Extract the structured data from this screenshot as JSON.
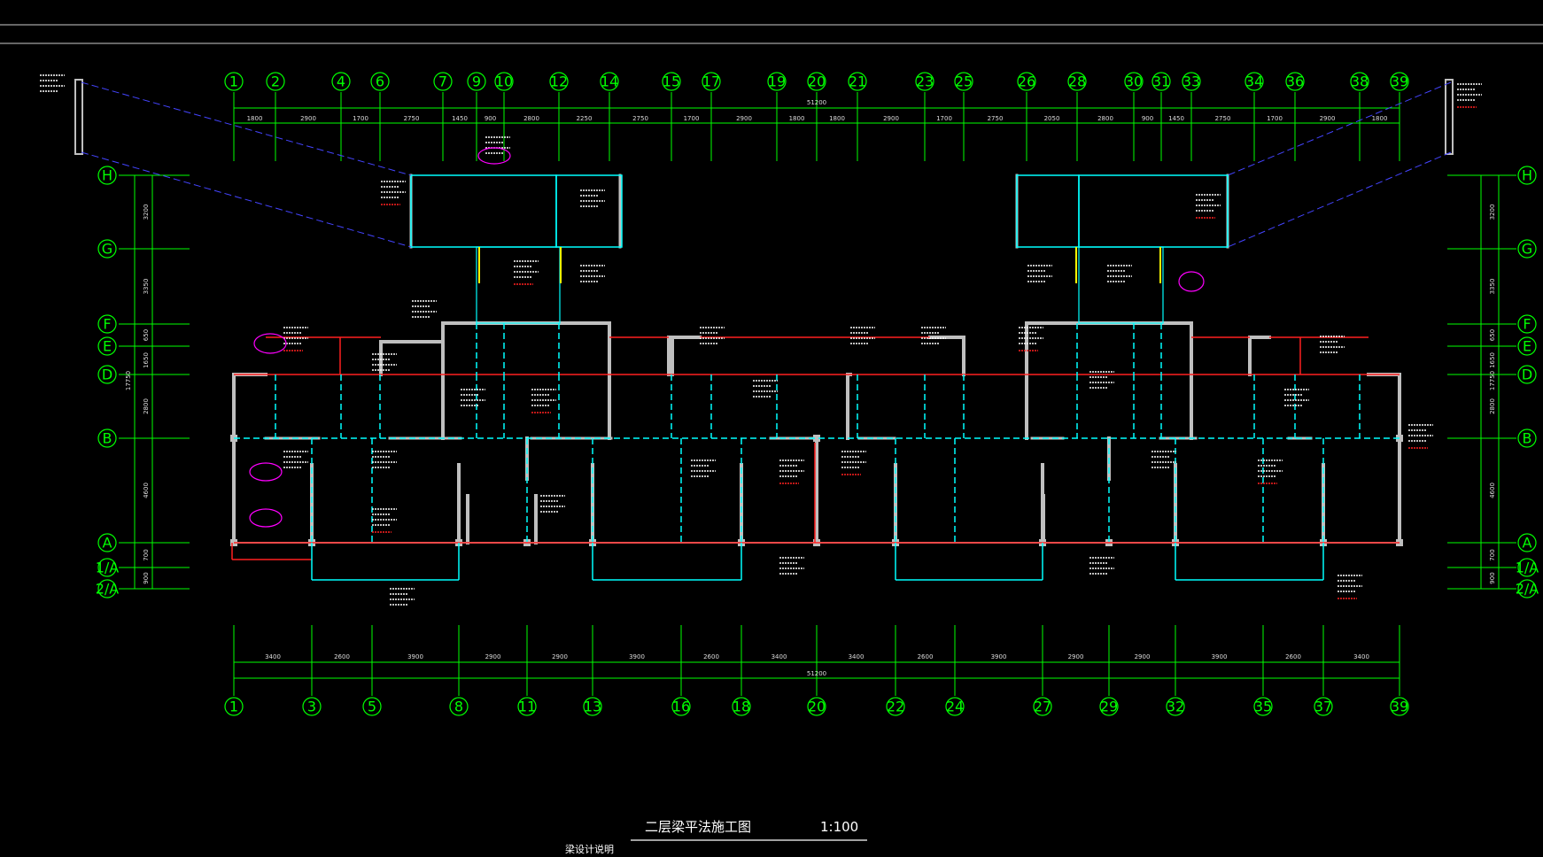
{
  "colors": {
    "background": "#000000",
    "grid": "#00ff00",
    "wall": "#bfbfbf",
    "beam_dashed": "#00ffff",
    "beam_red": "#ff2020",
    "annotation": "#ffffff",
    "highlight": "#ff00ff",
    "yellow": "#ffff00"
  },
  "drawing": {
    "title": "二层梁平法施工图",
    "scale": "1:100",
    "subtitle": "梁设计说明"
  },
  "top_axes": [
    "1",
    "2",
    "4",
    "6",
    "7",
    "9",
    "10",
    "12",
    "14",
    "15",
    "17",
    "19",
    "20",
    "21",
    "23",
    "25",
    "26",
    "28",
    "30",
    "31",
    "33",
    "34",
    "36",
    "38",
    "39"
  ],
  "top_dims": [
    "1800",
    "2900",
    "1700",
    "2750",
    "1450",
    "900",
    "2800",
    "2250",
    "2750",
    "1700",
    "2900",
    "1800",
    "1800",
    "2900",
    "1700",
    "2750",
    "2050",
    "2800",
    "900",
    "1450",
    "2750",
    "1700",
    "2900",
    "1800"
  ],
  "top_total": "51200",
  "bottom_axes": [
    "1",
    "3",
    "5",
    "8",
    "11",
    "13",
    "16",
    "18",
    "20",
    "22",
    "24",
    "27",
    "29",
    "32",
    "35",
    "37",
    "39"
  ],
  "bottom_dims": [
    "3400",
    "2600",
    "3900",
    "2900",
    "2900",
    "3900",
    "2600",
    "3400",
    "3400",
    "2600",
    "3900",
    "2900",
    "2900",
    "3900",
    "2600",
    "3400"
  ],
  "bottom_total": "51200",
  "row_axes": [
    "H",
    "G",
    "F",
    "E",
    "D",
    "B",
    "A",
    "1/A",
    "2/A"
  ],
  "left_dims": [
    "3200",
    "3350",
    "650",
    "1650",
    "2800",
    "4600",
    "700",
    "900"
  ],
  "left_total": "17750",
  "right_dims": [
    "3200",
    "3350",
    "650",
    "1650",
    "2800",
    "4600",
    "700",
    "900"
  ],
  "right_total": "17750"
}
